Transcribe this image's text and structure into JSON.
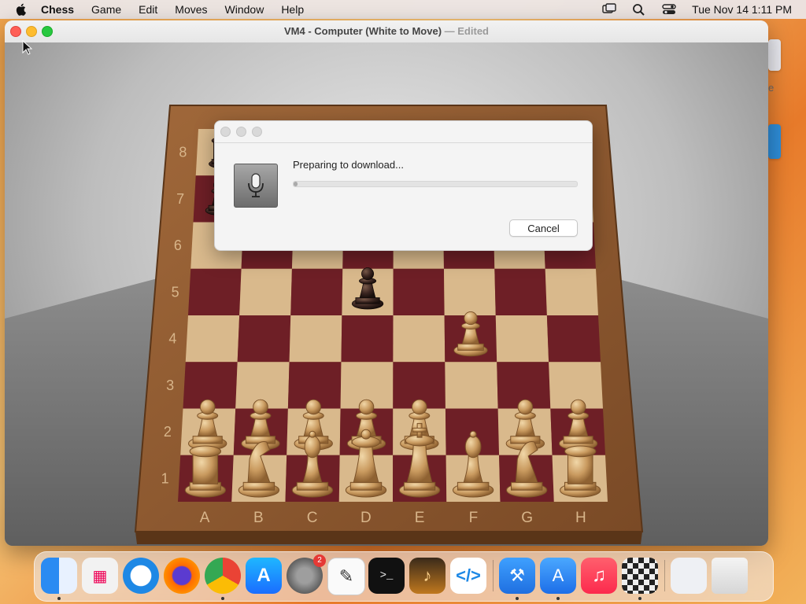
{
  "menubar": {
    "app_name": "Chess",
    "items": [
      "Game",
      "Edit",
      "Moves",
      "Window",
      "Help"
    ],
    "datetime": "Tue Nov 14  1:11 PM"
  },
  "window": {
    "title": "VM4 - Computer   (White to Move)",
    "separator": " — ",
    "status": "Edited"
  },
  "board": {
    "ranks": [
      "8",
      "7",
      "6",
      "5",
      "4",
      "3",
      "2",
      "1"
    ],
    "files": [
      "A",
      "B",
      "C",
      "D",
      "E",
      "F",
      "G",
      "H"
    ],
    "colors": {
      "light": "#d9b98c",
      "dark": "#6e1f26",
      "frame": "#8a5a32"
    }
  },
  "dialog": {
    "message": "Preparing to download...",
    "progress": 0.01,
    "cancel_label": "Cancel",
    "icon": "microphone-icon"
  },
  "side": {
    "partial_text": "e"
  },
  "dock": {
    "items": [
      {
        "name": "finder",
        "icon": "finder-icon",
        "running": true
      },
      {
        "name": "launchpad",
        "icon": "launchpad-icon",
        "running": false
      },
      {
        "name": "safari",
        "icon": "safari-icon",
        "running": false
      },
      {
        "name": "firefox",
        "icon": "firefox-icon",
        "running": false
      },
      {
        "name": "chrome",
        "icon": "chrome-icon",
        "running": true
      },
      {
        "name": "app-store",
        "icon": "app-store-icon",
        "running": false
      },
      {
        "name": "system-settings",
        "icon": "gear-icon",
        "running": false,
        "badge": "2"
      },
      {
        "name": "textedit",
        "icon": "textedit-icon",
        "running": false
      },
      {
        "name": "terminal",
        "icon": "terminal-icon",
        "running": false
      },
      {
        "name": "garageband",
        "icon": "guitar-icon",
        "running": false
      },
      {
        "name": "vscode",
        "icon": "vscode-icon",
        "running": false
      },
      {
        "name": "xcode",
        "icon": "hammer-icon",
        "running": true
      },
      {
        "name": "simulator",
        "icon": "simulator-icon",
        "running": true
      },
      {
        "name": "music",
        "icon": "music-icon",
        "running": false
      },
      {
        "name": "chess",
        "icon": "chess-icon",
        "running": true
      },
      {
        "name": "preview",
        "icon": "preview-icon",
        "running": false
      },
      {
        "name": "trash",
        "icon": "trash-icon",
        "running": false
      }
    ]
  }
}
